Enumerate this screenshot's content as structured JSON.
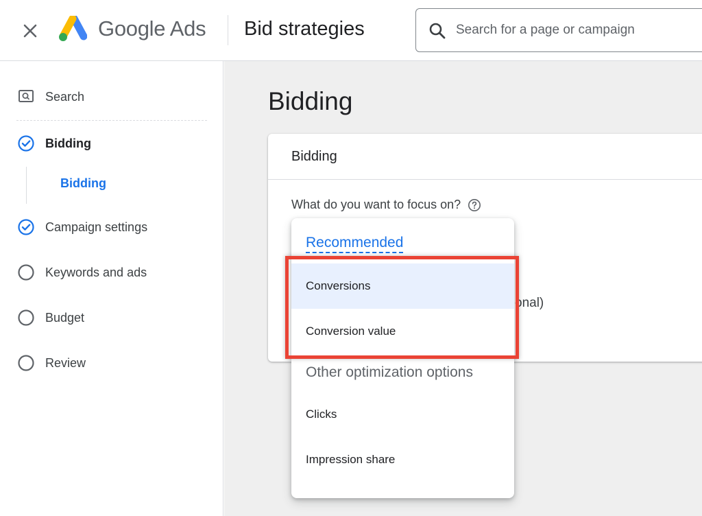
{
  "header": {
    "brand": "Google Ads",
    "page_name": "Bid strategies",
    "search_placeholder": "Search for a page or campaign"
  },
  "sidebar": {
    "search_label": "Search",
    "steps": [
      {
        "label": "Bidding",
        "status": "done",
        "current": true
      },
      {
        "label": "Campaign settings",
        "status": "done"
      },
      {
        "label": "Keywords and ads",
        "status": "pending"
      },
      {
        "label": "Budget",
        "status": "pending"
      },
      {
        "label": "Review",
        "status": "pending"
      }
    ],
    "substep": "Bidding"
  },
  "main": {
    "title": "Bidding",
    "card_title": "Bidding",
    "focus_question": "What do you want to focus on?",
    "partial_text": "onal)"
  },
  "menu": {
    "recommended_label": "Recommended",
    "recommended_items": [
      "Conversions",
      "Conversion value"
    ],
    "other_label": "Other optimization options",
    "other_items": [
      "Clicks",
      "Impression share"
    ],
    "selected": "Conversions"
  },
  "colors": {
    "accent": "#1a73e8",
    "highlight": "#ea4335",
    "selected_bg": "#e8f0fe",
    "logo_yellow": "#fbbc04",
    "logo_blue": "#4285f4",
    "logo_green": "#34a853"
  },
  "icons": {
    "close": "close-icon",
    "search": "search-icon",
    "sidebar_search": "search-box-icon",
    "done": "check-circle-icon",
    "pending": "empty-circle-icon",
    "help": "help-icon"
  }
}
